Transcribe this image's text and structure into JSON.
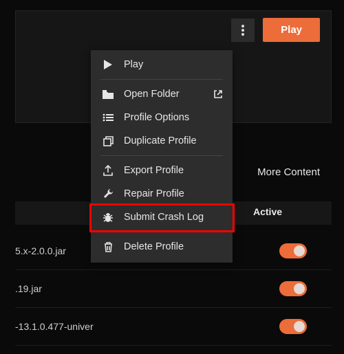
{
  "top": {
    "play_label": "Play"
  },
  "lower": {
    "more_content": "More Content",
    "active_header": "Active",
    "files": [
      {
        "name": "5.x-2.0.0.jar"
      },
      {
        "name": ".19.jar"
      },
      {
        "name": "-13.1.0.477-univer"
      }
    ]
  },
  "menu": {
    "play": "Play",
    "open_folder": "Open Folder",
    "profile_options": "Profile Options",
    "duplicate": "Duplicate Profile",
    "export": "Export Profile",
    "repair": "Repair Profile",
    "crash_log": "Submit Crash Log",
    "delete": "Delete Profile"
  }
}
